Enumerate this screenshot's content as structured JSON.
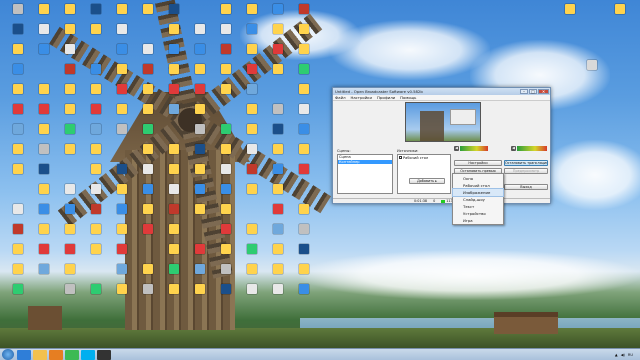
{
  "desktop": {
    "icons": [
      {
        "label": "",
        "color": "#c0c0c0"
      },
      {
        "label": "",
        "color": "#1b4f8a"
      },
      {
        "label": "",
        "color": "#ffd34d"
      },
      {
        "label": "",
        "color": "#3a8ee6"
      },
      {
        "label": "",
        "color": "#ffd34d"
      },
      {
        "label": "",
        "color": "#e03a3a"
      },
      {
        "label": "",
        "color": "#6fa8dc"
      },
      {
        "label": "",
        "color": "#ffd34d"
      },
      {
        "label": "",
        "color": "#ffd34d"
      },
      {
        "label": "",
        "color": "#e8e8e8"
      },
      {
        "label": "",
        "color": "#c0392b"
      },
      {
        "label": "",
        "color": "#ffd34d"
      },
      {
        "label": "",
        "color": "#ffd34d"
      },
      {
        "label": "",
        "color": "#2ecc71"
      },
      {
        "label": "",
        "color": "#ffd34d"
      },
      {
        "label": "",
        "color": "#e8e8e8"
      },
      {
        "label": "",
        "color": "#3a8ee6"
      },
      {
        "label": "",
        "color": "#ffd34d"
      },
      {
        "label": "",
        "color": "#e03a3a"
      },
      {
        "label": "",
        "color": "#ffd34d"
      }
    ],
    "right_icons": [
      {
        "label": "",
        "color": "#ffd34d"
      },
      {
        "label": "",
        "color": "#ffd34d"
      },
      {
        "label": "",
        "color": "#d9d9d9"
      }
    ]
  },
  "obs": {
    "title": "Untitled - Open Broadcaster Software v0.582b",
    "menu": [
      "Файл",
      "Настройки",
      "Профили",
      "Помощь"
    ],
    "scenes_label": "Сцены:",
    "scenes": [
      "Сцена",
      "Контейнер"
    ],
    "sources_label": "Источники:",
    "sources": [
      {
        "label": "Рабочий стол",
        "checked": true
      }
    ],
    "buttons": {
      "settings": "Настройки",
      "start_stream": "Остановить трансляцию",
      "stop_preview": "Остановить превью",
      "preview": "Предпросмотр",
      "plugins": "Плагины",
      "exit": "Выход",
      "add": "Добавить"
    },
    "status": {
      "time": "0:01:38",
      "dropped": "0",
      "bitrate": "1134kb/s",
      "indicator_color": "#22cc22"
    },
    "meter_levels": {
      "mic": 0.55,
      "desktop": 0.6
    }
  },
  "context_menu": {
    "items": [
      "Окно",
      "Рабочий стол",
      "Изображение",
      "Слайд-шоу",
      "Текст",
      "Устройство",
      "Игра"
    ],
    "highlighted_index": 2
  },
  "taskbar": {
    "apps": [
      {
        "name": "ie-icon",
        "color": "#2f7ed8"
      },
      {
        "name": "explorer-icon",
        "color": "#f2c14e"
      },
      {
        "name": "media-icon",
        "color": "#e67e22"
      },
      {
        "name": "chrome-icon",
        "color": "#3cba54"
      },
      {
        "name": "skype-icon",
        "color": "#00aff0"
      },
      {
        "name": "obs-icon",
        "color": "#333333"
      }
    ],
    "language": "RU",
    "time": "",
    "date": ""
  }
}
